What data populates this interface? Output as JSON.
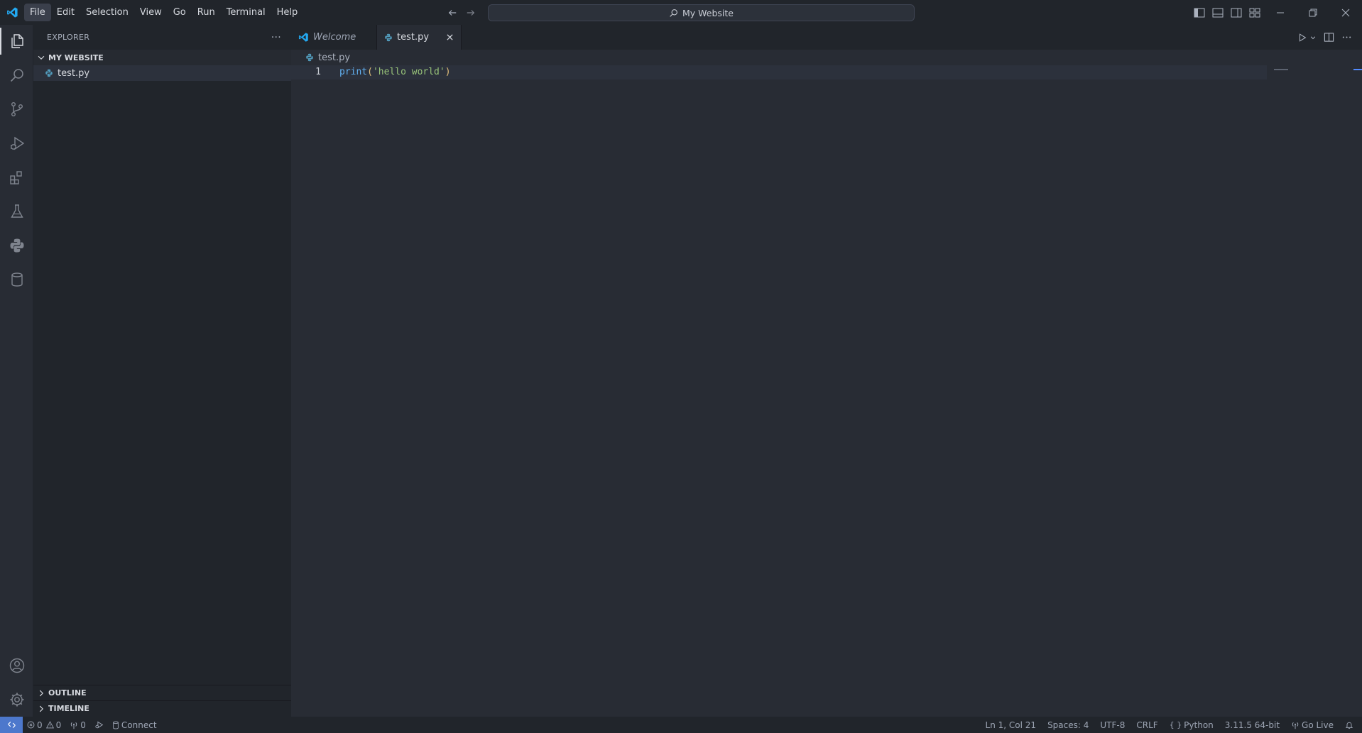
{
  "titlebar": {
    "menu": [
      "File",
      "Edit",
      "Selection",
      "View",
      "Go",
      "Run",
      "Terminal",
      "Help"
    ],
    "command_center": "My Website"
  },
  "sidebar": {
    "title": "EXPLORER",
    "more_actions": "···",
    "folder": "MY WEBSITE",
    "files": [
      "test.py"
    ],
    "outline": "OUTLINE",
    "timeline": "TIMELINE"
  },
  "tabs": [
    {
      "label": "Welcome",
      "active": false
    },
    {
      "label": "test.py",
      "active": true
    }
  ],
  "breadcrumb": "test.py",
  "code": {
    "line_number": "1",
    "fn": "print",
    "open_paren": "(",
    "string": "'hello world'",
    "close_paren": ")"
  },
  "statusbar": {
    "errors": "0",
    "warnings": "0",
    "ports": "0",
    "connect": "Connect",
    "cursor": "Ln 1, Col 21",
    "spaces": "Spaces: 4",
    "encoding": "UTF-8",
    "eol": "CRLF",
    "language": "Python",
    "interpreter": "3.11.5 64-bit",
    "golive": "Go Live"
  },
  "colors": {
    "accent": "#4d78cc",
    "vscode_logo": "#23a9f2",
    "python_file_icon": "#519aba"
  }
}
